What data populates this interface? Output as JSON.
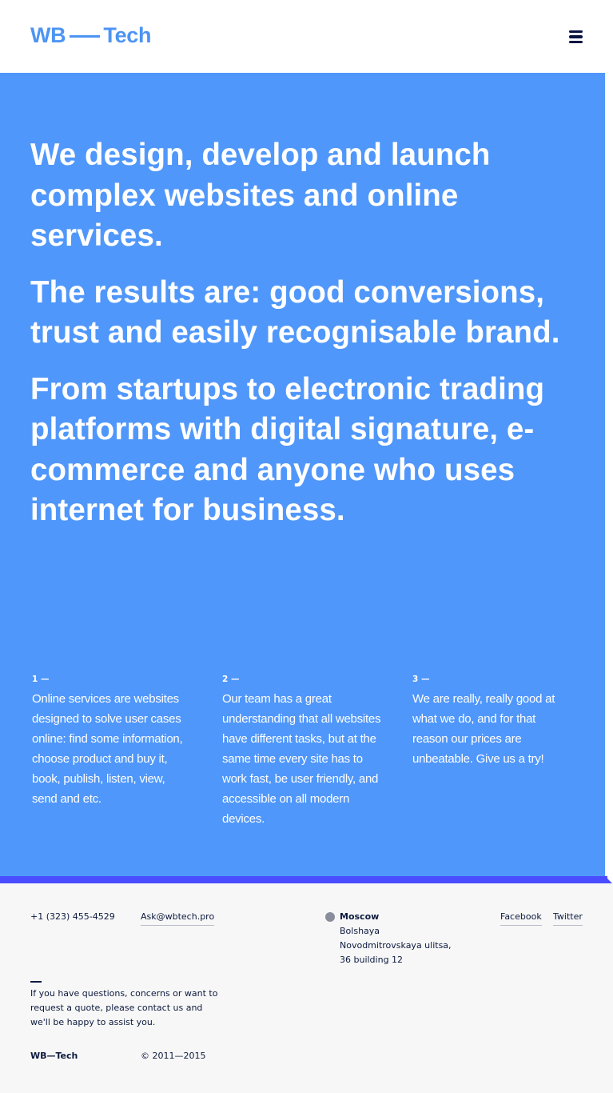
{
  "header": {
    "logo_left": "WB",
    "logo_right": "Tech",
    "menu_icon": "hamburger-menu-icon"
  },
  "hero": {
    "paragraphs": [
      "We design, develop and launch complex websites and online services.",
      "The results are: good conversions, trust and easily recognisable brand.",
      "From startups to electronic trading platforms with digital signature, e-commerce and anyone who uses internet for business."
    ],
    "columns": [
      {
        "number": "1 —",
        "text": "Online services are websites designed to solve user cases online: find some information, choose product and buy it, book, publish, listen, view, send and etc."
      },
      {
        "number": "2 —",
        "text": "Our team has a great understanding that all websites have different tasks, but at the same time every site has to work fast, be user friendly, and accessible on all modern devices."
      },
      {
        "number": "3 —",
        "text": "We are really, really good at what we do, and for that reason our prices are unbeatable. Give us a try!"
      }
    ]
  },
  "footer": {
    "phone": "+1 (323) 455-4529",
    "email": "Ask@wbtech.pro",
    "city": "Moscow",
    "address_lines": [
      "Bolshaya",
      "Novodmitrovskaya ulitsa,",
      "36 building 12"
    ],
    "social": {
      "facebook": "Facebook",
      "twitter": "Twitter"
    },
    "note": "If you have questions, concerns or want to request a quote, please contact us and we'll be happy to assist you.",
    "brand": "WB—Tech",
    "copyright": "© 2011—2015"
  },
  "colors": {
    "brand_blue": "#4d94f4",
    "hero_bg": "#5097fb",
    "accent_stripe": "#4a4cff",
    "footer_bg": "#f7f7f7",
    "ink": "#0c1a3e"
  }
}
